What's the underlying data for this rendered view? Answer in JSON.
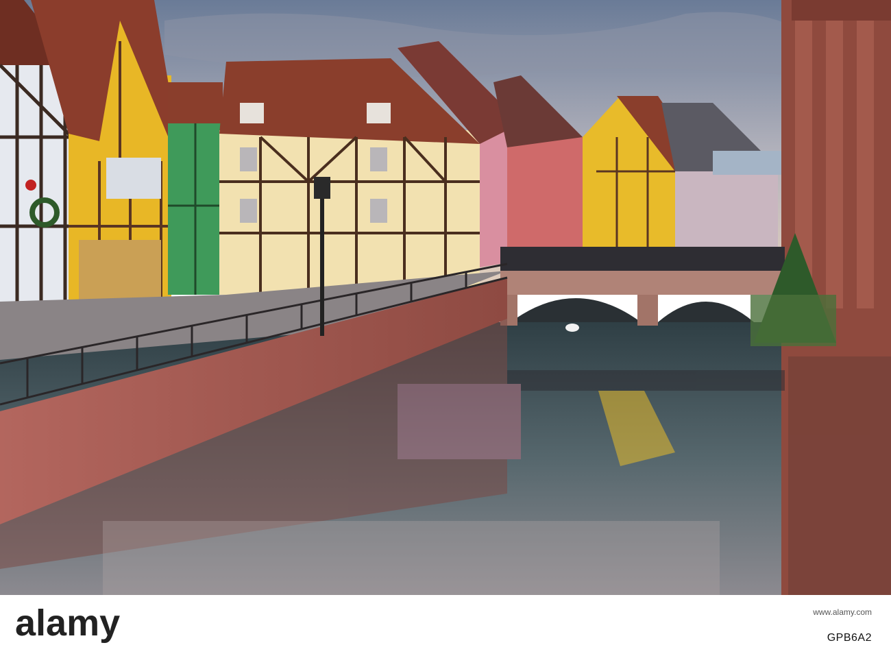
{
  "photo": {
    "subject": "photo",
    "colors": {
      "sky_top": "#6d7e9a",
      "sky_bottom": "#d9c7b8",
      "water": "#3a4e57",
      "canal_wall": "#b8605a",
      "yellow_house": "#e8bb2a",
      "roof": "#8a3e2c",
      "green_house": "#3f9a5a",
      "pink_house": "#d98fa0"
    }
  },
  "watermark": {
    "brand": "alamy",
    "image_id": "GPB6A2",
    "site": "www.alamy.com"
  }
}
